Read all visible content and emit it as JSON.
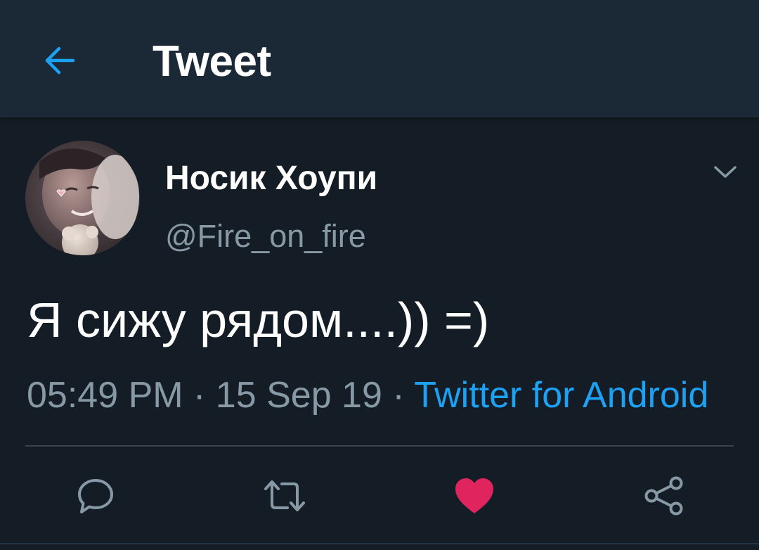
{
  "header": {
    "title": "Tweet",
    "back_icon": "arrow-left-icon"
  },
  "tweet": {
    "display_name": "Носик Хоупи",
    "handle": "@Fire_on_fire",
    "text": "Я сижу рядом....)) =)",
    "time": "05:49 PM",
    "separator": " · ",
    "date": "15 Sep 19",
    "source": "Twitter for Android",
    "liked": true
  },
  "actions": [
    {
      "name": "reply",
      "icon": "comment-icon"
    },
    {
      "name": "retweet",
      "icon": "retweet-icon"
    },
    {
      "name": "like",
      "icon": "heart-icon"
    },
    {
      "name": "share",
      "icon": "share-icon"
    }
  ],
  "colors": {
    "background": "#141d26",
    "header": "#1b2836",
    "accent": "#1da1f2",
    "secondary_text": "#8899a6",
    "like": "#e0245e"
  }
}
